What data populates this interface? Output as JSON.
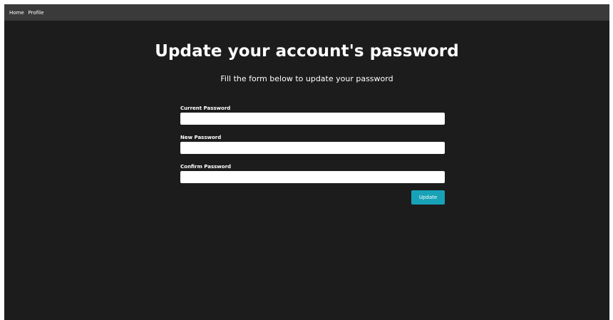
{
  "nav": {
    "items": [
      {
        "label": "Home"
      },
      {
        "label": "Profile"
      }
    ]
  },
  "header": {
    "title": "Update your account's password",
    "subtitle": "Fill the form below to update your password"
  },
  "form": {
    "fields": [
      {
        "label": "Current Password",
        "value": "",
        "placeholder": ""
      },
      {
        "label": "New Password",
        "value": "",
        "placeholder": ""
      },
      {
        "label": "Confirm Password",
        "value": "",
        "placeholder": ""
      }
    ],
    "submit_label": "Update"
  },
  "colors": {
    "page_background": "#1c1c1c",
    "navbar_background": "#3a3a3a",
    "button_accent": "#17a2b8",
    "text": "#ffffff"
  }
}
